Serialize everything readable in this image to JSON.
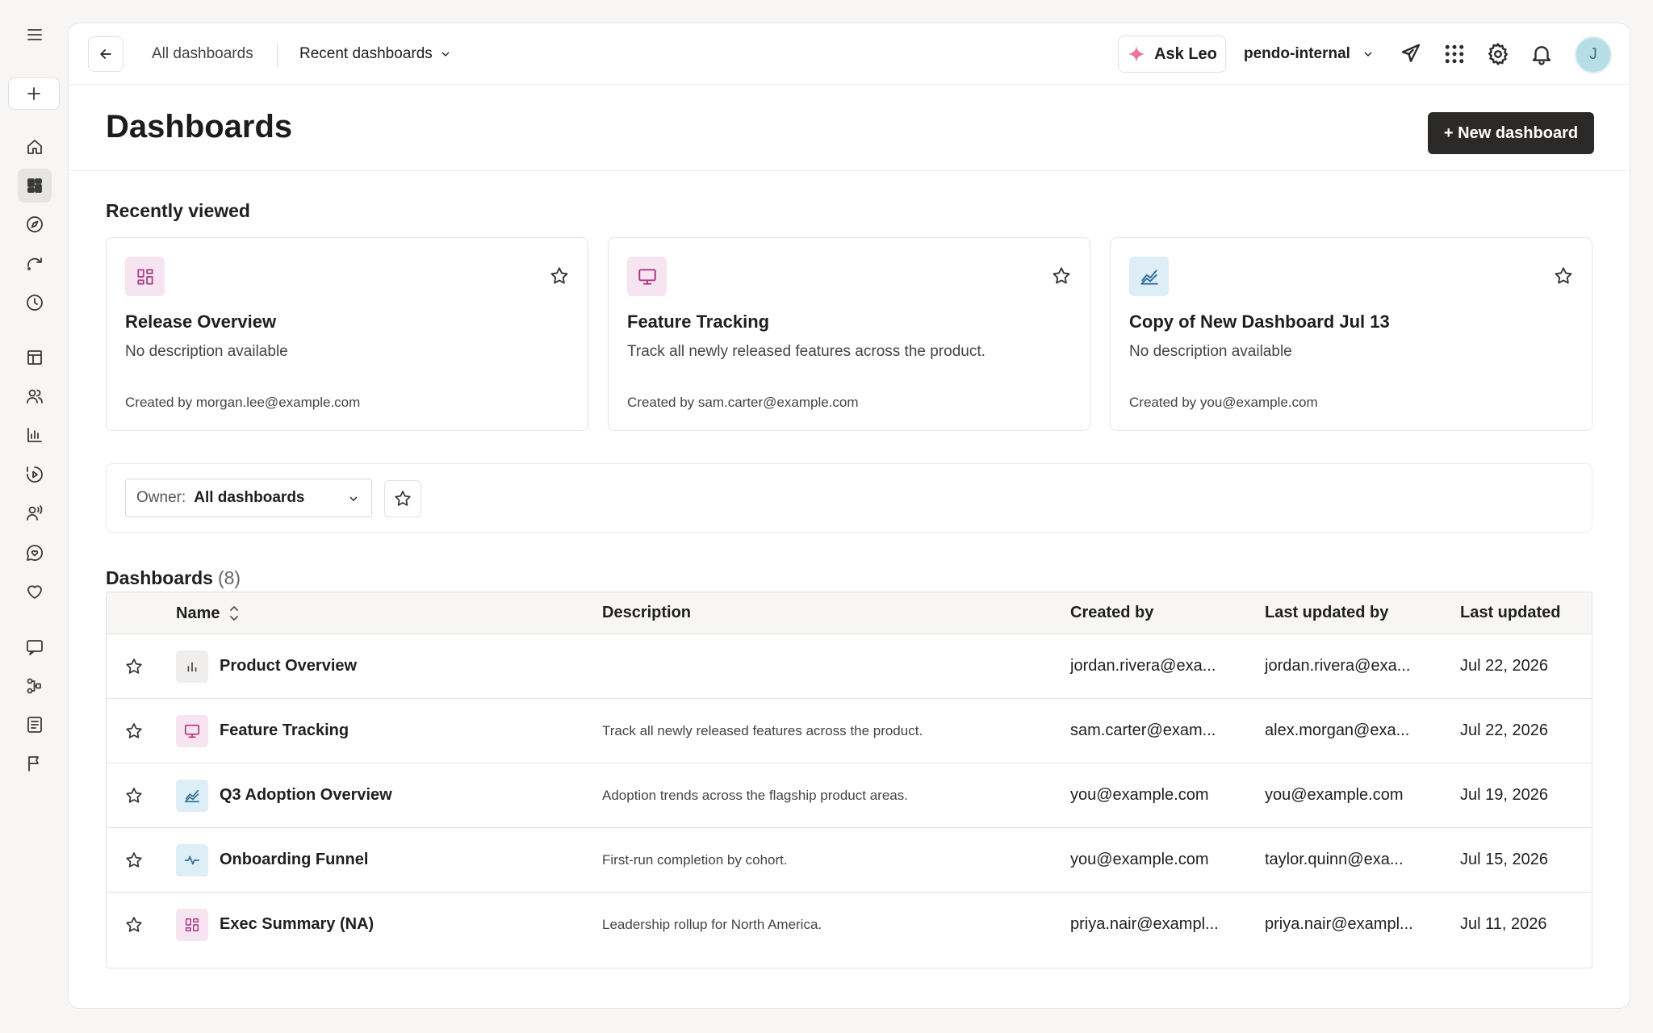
{
  "sidebar": {
    "menu_icon": "menu-icon",
    "add_icon": "plus-icon",
    "items": [
      {
        "icon": "home-icon"
      },
      {
        "icon": "dashboard-icon"
      },
      {
        "icon": "compass-icon"
      },
      {
        "icon": "redo-icon"
      },
      {
        "icon": "clock-icon"
      },
      {
        "icon": "layout-icon"
      },
      {
        "icon": "users-icon"
      },
      {
        "icon": "bar-chart-icon"
      },
      {
        "icon": "play-circle-icon"
      },
      {
        "icon": "user-voice-icon"
      },
      {
        "icon": "chat-heart-icon"
      },
      {
        "icon": "heart-icon"
      },
      {
        "icon": "message-icon"
      },
      {
        "icon": "flow-icon"
      },
      {
        "icon": "document-icon"
      },
      {
        "icon": "flag-icon"
      }
    ]
  },
  "topbar": {
    "breadcrumb_all": "All dashboards",
    "breadcrumb_recent": "Recent dashboards",
    "ask_leo": "Ask Leo",
    "org": "pendo-internal",
    "avatar_initial": "J"
  },
  "page": {
    "title": "Dashboards",
    "new_button": "+ New dashboard"
  },
  "recently_viewed": {
    "title": "Recently viewed",
    "cards": [
      {
        "title": "Release Overview",
        "description": "No description available",
        "creator": "Created by morgan.lee@example.com",
        "icon": "grid-icon",
        "icon_bg": "#f6e4f0",
        "icon_color": "#a8478d"
      },
      {
        "title": "Feature Tracking",
        "description": "Track all newly released features across the product.",
        "creator": "Created by sam.carter@example.com",
        "icon": "monitor-icon",
        "icon_bg": "#f6e4f0",
        "icon_color": "#b0357f"
      },
      {
        "title": "Copy of New Dashboard Jul 13",
        "description": "No description available",
        "creator": "Created by you@example.com",
        "icon": "trend-icon",
        "icon_bg": "#ddeef6",
        "icon_color": "#2f6f95"
      }
    ]
  },
  "filter": {
    "owner_label": "Owner:",
    "owner_value": "All dashboards"
  },
  "table": {
    "title": "Dashboards",
    "count": "(8)",
    "columns": [
      "Name",
      "Description",
      "Created by",
      "Last updated by",
      "Last updated"
    ],
    "rows": [
      {
        "name": "Product Overview",
        "description": "",
        "created_by": "jordan.rivera@exa...",
        "updated_by": "jordan.rivera@exa...",
        "updated": "Jul 22, 2026",
        "icon": "bar-chart-icon",
        "icon_bg": "#efeeec",
        "icon_color": "#444444"
      },
      {
        "name": "Feature Tracking",
        "description": "Track all newly released features across the product.",
        "created_by": "sam.carter@exam...",
        "updated_by": "alex.morgan@exa...",
        "updated": "Jul 22, 2026",
        "icon": "monitor-icon",
        "icon_bg": "#f6e4f0",
        "icon_color": "#b0357f"
      },
      {
        "name": "Q3 Adoption Overview",
        "description": "Adoption trends across the flagship product areas.",
        "created_by": "you@example.com",
        "updated_by": "you@example.com",
        "updated": "Jul 19, 2026",
        "icon": "trend-icon",
        "icon_bg": "#ddeef6",
        "icon_color": "#2f6f95"
      },
      {
        "name": "Onboarding Funnel",
        "description": "First-run completion by cohort.",
        "created_by": "you@example.com",
        "updated_by": "taylor.quinn@exa...",
        "updated": "Jul 15, 2026",
        "icon": "pulse-icon",
        "icon_bg": "#ddeef6",
        "icon_color": "#2f6f95"
      },
      {
        "name": "Exec Summary (NA)",
        "description": "Leadership rollup for North America.",
        "created_by": "priya.nair@exampl...",
        "updated_by": "priya.nair@exampl...",
        "updated": "Jul 11, 2026",
        "icon": "grid-icon",
        "icon_bg": "#f6e4f0",
        "icon_color": "#a8478d"
      }
    ]
  }
}
